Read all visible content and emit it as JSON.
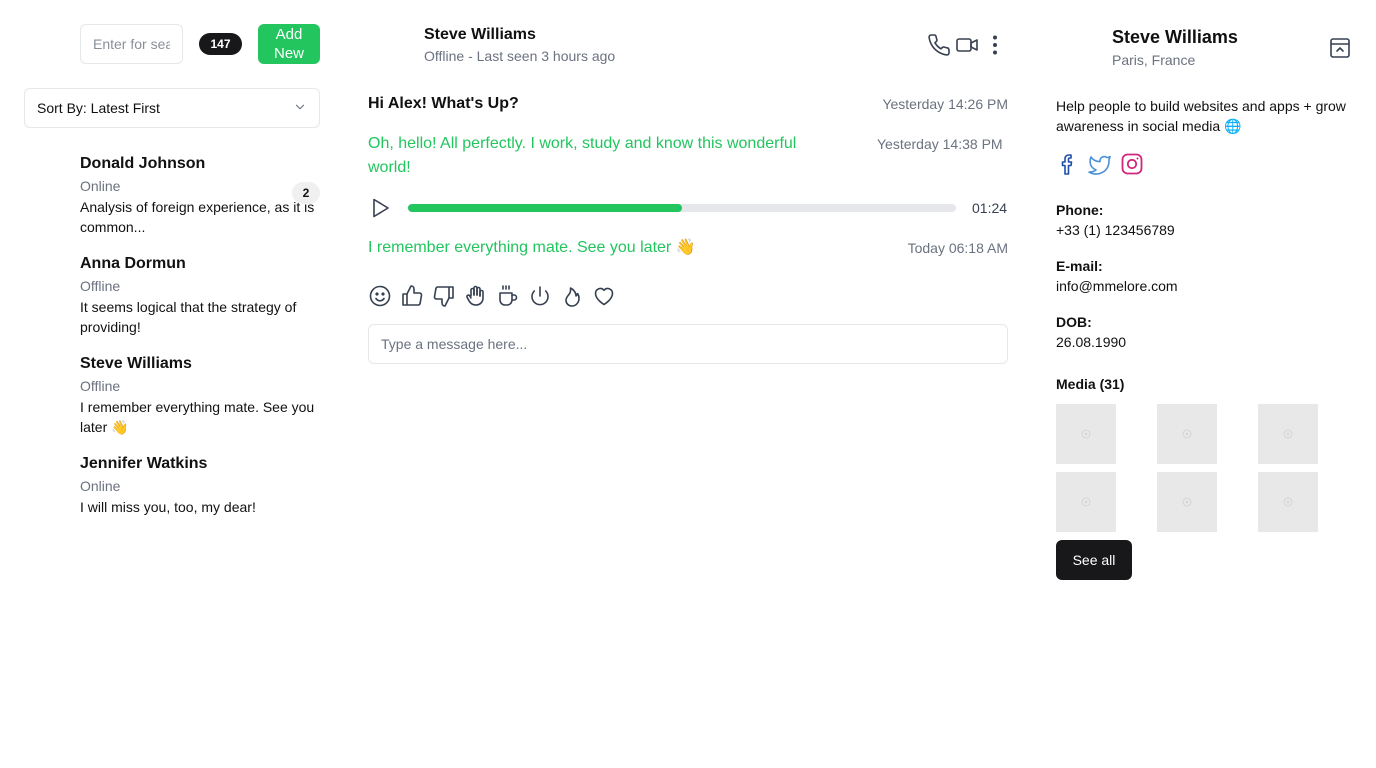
{
  "sidebar": {
    "search_placeholder": "Enter for search...",
    "count": "147",
    "add_label": "Add\nNew",
    "sort_label": "Sort By: Latest First",
    "contacts": [
      {
        "name": "Donald Johnson",
        "status": "Online",
        "message": "Analysis of foreign experience, as it is common...",
        "unread": "2"
      },
      {
        "name": "Anna Dormun",
        "status": "Offline",
        "message": "It seems logical that the strategy of providing!"
      },
      {
        "name": "Steve Williams",
        "status": "Offline",
        "message": "I remember everything mate. See you later 👋"
      },
      {
        "name": "Jennifer Watkins",
        "status": "Online",
        "message": "I will miss you, too, my dear!"
      }
    ]
  },
  "chat": {
    "name": "Steve Williams",
    "status": "Offline - Last seen 3 hours ago",
    "messages": [
      {
        "text": "Hi Alex! What's Up?",
        "time": "Yesterday 14:26 PM"
      },
      {
        "text": "Oh, hello! All perfectly. I work, study and know this wonderful world!",
        "time": "Yesterday 14:38 PM"
      },
      {
        "text": "I remember everything mate. See you later 👋",
        "time": "Today 06:18 AM"
      }
    ],
    "audio": {
      "duration": "01:24",
      "progress": 0.5
    },
    "input_placeholder": "Type a message here...",
    "reaction_icons": [
      "smile-icon",
      "thumbs-up-icon",
      "thumbs-down-icon",
      "hand-icon",
      "coffee-icon",
      "power-icon",
      "flame-icon",
      "heart-icon"
    ]
  },
  "profile": {
    "name": "Steve Williams",
    "location": "Paris, France",
    "bio": "Help people to build websites and apps + grow awareness in social media 🌐",
    "phone_label": "Phone:",
    "phone": "+33 (1) 123456789",
    "email_label": "E-mail:",
    "email": "info@mmelore.com",
    "dob_label": "DOB:",
    "dob": "26.08.1990",
    "media_title": "Media (31)",
    "see_all": "See all",
    "social": [
      {
        "icon": "facebook-icon",
        "color": "#1e4ea8"
      },
      {
        "icon": "twitter-icon",
        "color": "#4a90d9"
      },
      {
        "icon": "instagram-icon",
        "color": "#d1277a"
      }
    ]
  },
  "colors": {
    "accent": "#22c55e",
    "dark": "#18181b",
    "muted": "#6b7280"
  }
}
